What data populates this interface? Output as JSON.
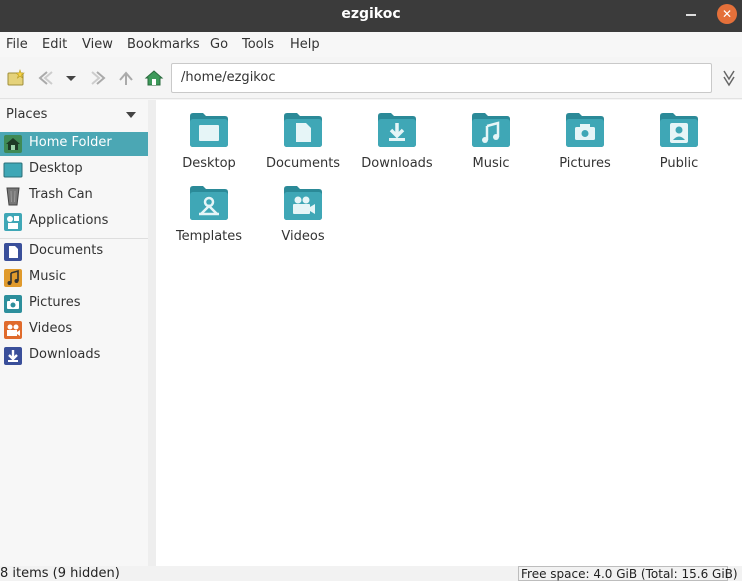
{
  "window": {
    "title": "ezgikoc"
  },
  "menu": [
    "File",
    "Edit",
    "View",
    "Bookmarks",
    "Go",
    "Tools",
    "Help"
  ],
  "location": {
    "path": "/home/ezgikoc"
  },
  "sidebar": {
    "header": "Places",
    "items": [
      {
        "label": "Home Folder",
        "icon": "home-icon",
        "selected": true
      },
      {
        "label": "Desktop",
        "icon": "desktop-icon"
      },
      {
        "label": "Trash Can",
        "icon": "trash-icon"
      },
      {
        "label": "Applications",
        "icon": "applications-icon"
      },
      {
        "label": "Documents",
        "icon": "documents-icon"
      },
      {
        "label": "Music",
        "icon": "music-icon"
      },
      {
        "label": "Pictures",
        "icon": "pictures-icon"
      },
      {
        "label": "Videos",
        "icon": "videos-icon"
      },
      {
        "label": "Downloads",
        "icon": "downloads-icon"
      }
    ]
  },
  "folders": [
    {
      "label": "Desktop",
      "icon": "folder-desktop-icon"
    },
    {
      "label": "Documents",
      "icon": "folder-documents-icon"
    },
    {
      "label": "Downloads",
      "icon": "folder-downloads-icon"
    },
    {
      "label": "Music",
      "icon": "folder-music-icon"
    },
    {
      "label": "Pictures",
      "icon": "folder-pictures-icon"
    },
    {
      "label": "Public",
      "icon": "folder-public-icon"
    },
    {
      "label": "Templates",
      "icon": "folder-templates-icon"
    },
    {
      "label": "Videos",
      "icon": "folder-videos-icon"
    }
  ],
  "status": {
    "left": "8 items (9 hidden)",
    "right": "Free space: 4.0 GiB (Total: 15.6 GiB)"
  },
  "colors": {
    "folder": "#3fa7b6",
    "folder_dark": "#2b8a98",
    "accent": "#4ba7b4",
    "titlebar": "#3b3b3b",
    "close": "#e4703a"
  }
}
